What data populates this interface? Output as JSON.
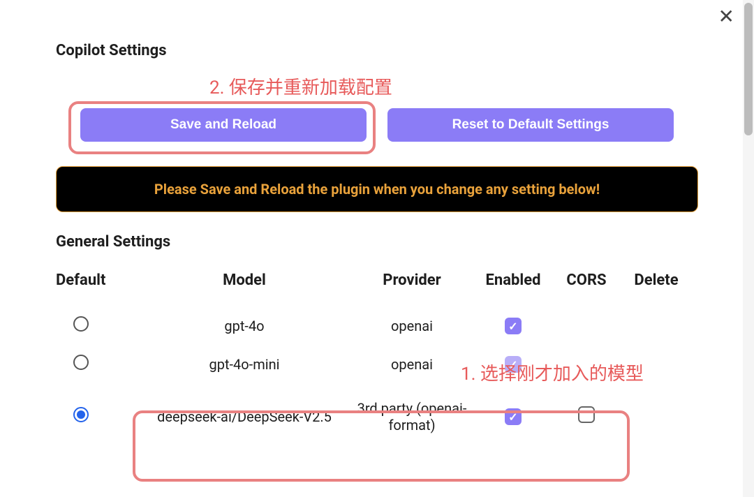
{
  "close_glyph": "✕",
  "header": {
    "title": "Copilot Settings"
  },
  "buttons": {
    "save_reload": "Save and Reload",
    "reset_defaults": "Reset to Default Settings"
  },
  "banner": "Please Save and Reload the plugin when you change any setting below!",
  "general_heading": "General Settings",
  "columns": {
    "default": "Default",
    "model": "Model",
    "provider": "Provider",
    "enabled": "Enabled",
    "cors": "CORS",
    "delete": "Delete"
  },
  "rows": [
    {
      "default_selected": false,
      "model": "gpt-4o",
      "provider": "openai",
      "enabled": true,
      "enabled_dim": false,
      "cors_visible": false,
      "delete_visible": false
    },
    {
      "default_selected": false,
      "model": "gpt-4o-mini",
      "provider": "openai",
      "enabled": true,
      "enabled_dim": true,
      "cors_visible": false,
      "delete_visible": false
    },
    {
      "default_selected": true,
      "model": "deepseek-ai/DeepSeek-V2.5",
      "provider": "3rd party (openai-format)",
      "enabled": true,
      "enabled_dim": false,
      "cors_visible": true,
      "cors_checked": false,
      "delete_visible": false
    }
  ],
  "annotations": {
    "step1": "1. 选择刚才加入的模型",
    "step2": "2. 保存并重新加载配置"
  },
  "colors": {
    "accent": "#8b7cf6",
    "annotation": "#e75a5a",
    "banner_bg": "#000000",
    "banner_fg": "#e9a23b"
  }
}
